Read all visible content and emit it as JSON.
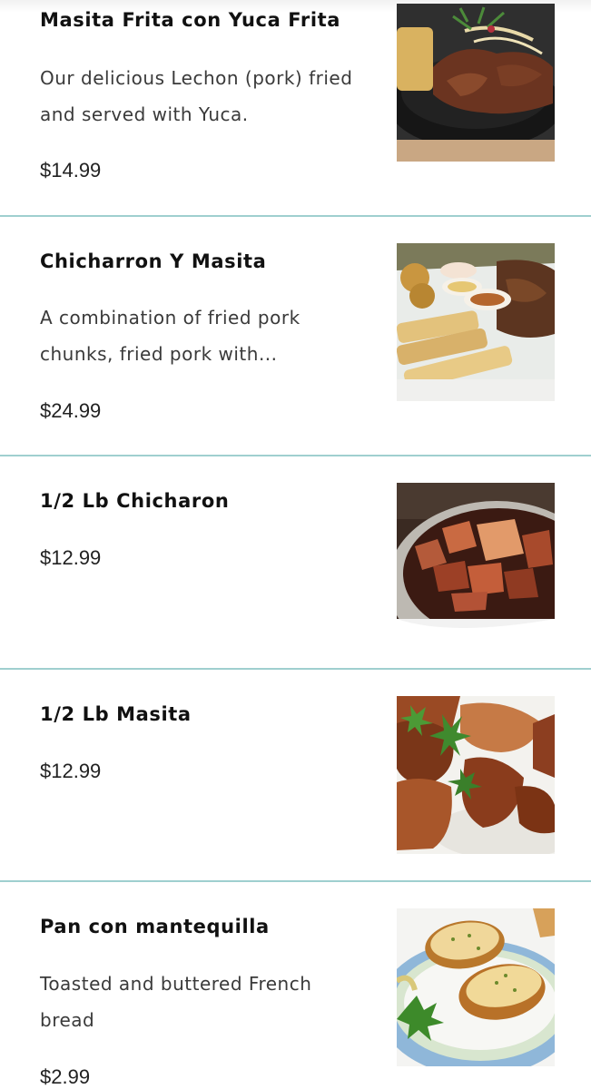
{
  "menu": {
    "items": [
      {
        "name": "Masita Frita con Yuca Frita",
        "description": "Our delicious Lechon (pork) fried and served with Yuca.",
        "price": "$14.99",
        "photo": "fried-pork-skillet-photo"
      },
      {
        "name": "Chicharron Y Masita",
        "description": "A combination of fried pork chunks, fried pork with...",
        "price": "$24.99",
        "photo": "pork-and-yuca-platter-photo"
      },
      {
        "name": "1/2 Lb Chicharon",
        "description": "",
        "price": "$12.99",
        "photo": "chicharron-bowl-photo"
      },
      {
        "name": "1/2 Lb Masita",
        "description": "",
        "price": "$12.99",
        "photo": "masita-plate-photo"
      },
      {
        "name": "Pan con mantequilla",
        "description": "Toasted and buttered French bread",
        "price": "$2.99",
        "photo": "buttered-bread-photo"
      }
    ]
  },
  "colors": {
    "divider": "#9fcfcf",
    "text": "#1f1f1f",
    "background": "#ffffff"
  }
}
